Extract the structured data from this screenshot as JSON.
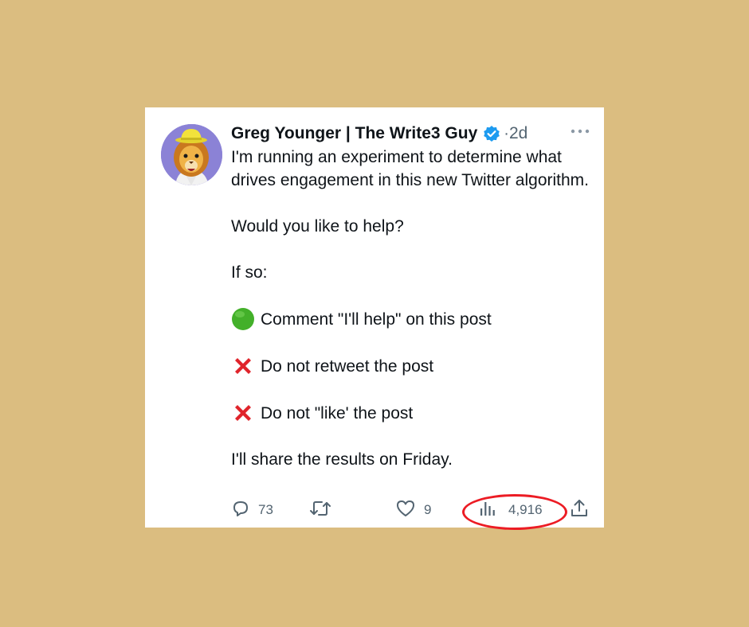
{
  "tweet": {
    "author_name": "Greg Younger | The Write3 Guy",
    "separator": "·",
    "time": "2d",
    "body": {
      "line1": "I'm running an experiment to determine what drives engagement in this new Twitter algorithm.",
      "line2": "Would you like to help?",
      "line3": "If so:",
      "item_comment": "Comment \"I'll help\" on this post",
      "item_retweet": "Do not retweet the post",
      "item_like": "Do not \"like' the post",
      "line_last": "I'll share the results on Friday."
    },
    "actions": {
      "reply_count": "73",
      "like_count": "9",
      "views_count": "4,916"
    }
  },
  "icons": {
    "verified": "verified-badge-icon",
    "more": "more-horizontal-icon",
    "reply": "reply-bubble-icon",
    "retweet": "retweet-icon",
    "like": "heart-icon",
    "views": "bar-chart-icon",
    "share": "share-upload-icon",
    "green_circle": "green-circle-emoji",
    "red_x": "red-cross-emoji"
  },
  "colors": {
    "background": "#dbbd80",
    "card": "#ffffff",
    "text": "#0f1419",
    "muted": "#536471",
    "verified": "#1d9bf0",
    "highlight": "#ec1c24",
    "avatar_bg": "#8b82d6"
  }
}
